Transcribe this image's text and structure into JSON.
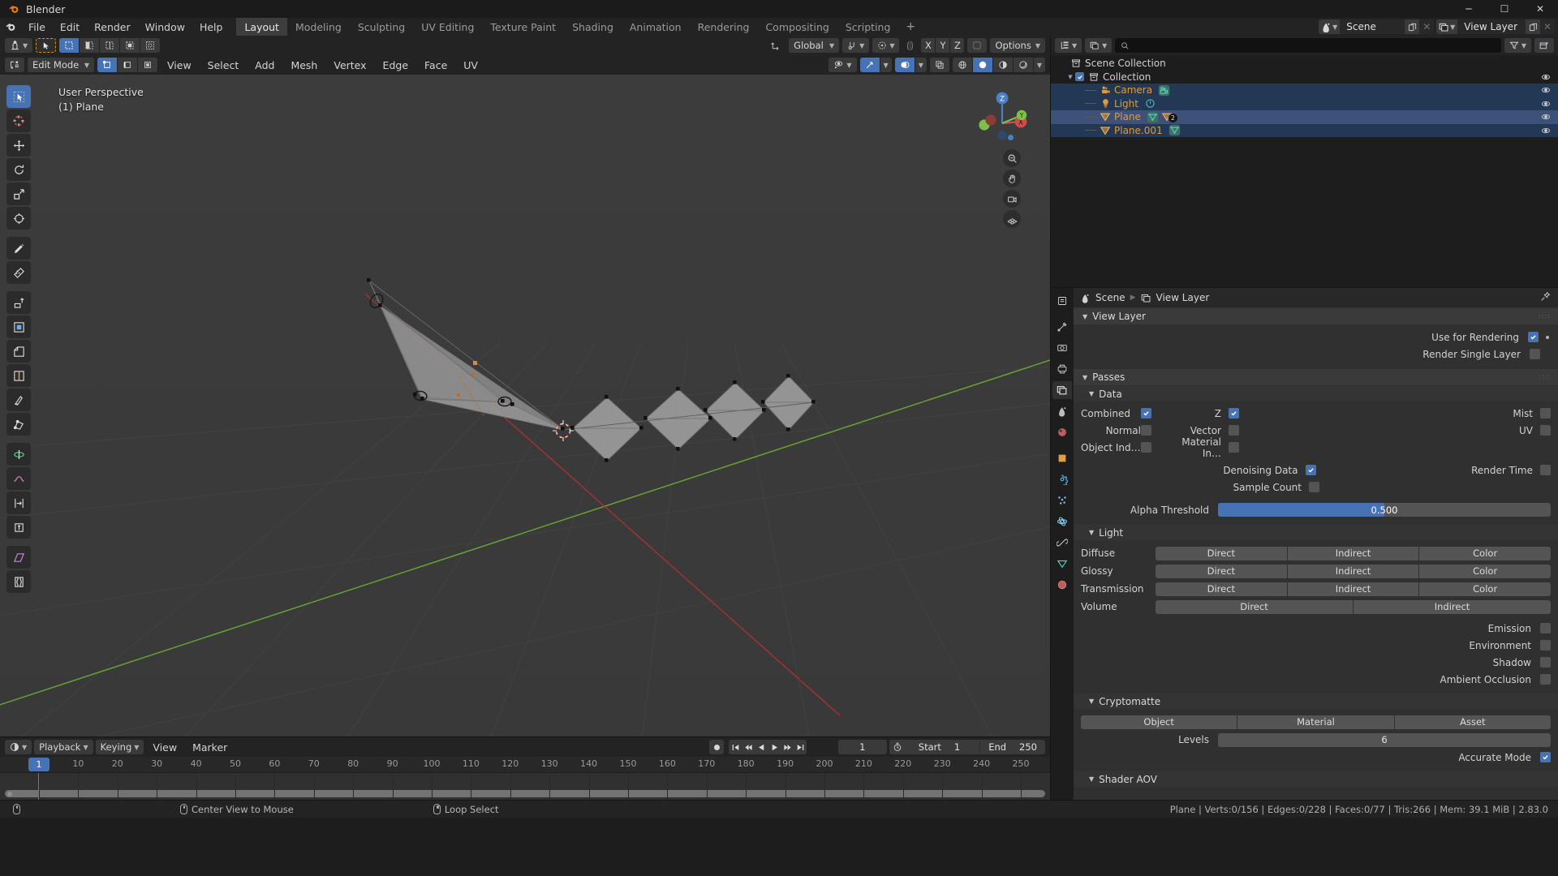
{
  "window": {
    "title": "Blender",
    "minimize": "─",
    "maximize": "☐",
    "close": "✕"
  },
  "topbar": {
    "menus": [
      "File",
      "Edit",
      "Render",
      "Window",
      "Help"
    ],
    "workspaces": [
      "Layout",
      "Modeling",
      "Sculpting",
      "UV Editing",
      "Texture Paint",
      "Shading",
      "Animation",
      "Rendering",
      "Compositing",
      "Scripting"
    ],
    "active_workspace": "Layout",
    "add_workspace": "+",
    "scene": {
      "label": "Scene",
      "icon": "scene-icon",
      "new_btn": "new-scene-icon",
      "close_btn": "✕"
    },
    "view_layer": {
      "label": "View Layer",
      "icon": "view-layer-icon",
      "new_btn": "new-layer-icon",
      "close_btn": "✕"
    }
  },
  "tool_header": {
    "transform_orientation": "Global",
    "options_label": "Options",
    "proportional_axes": [
      "X",
      "Y",
      "Z"
    ]
  },
  "viewport_header": {
    "mode": "Edit Mode",
    "menus": [
      "View",
      "Select",
      "Add",
      "Mesh",
      "Vertex",
      "Edge",
      "Face",
      "UV"
    ],
    "select_modes": [
      "vertex-select",
      "edge-select",
      "face-select"
    ],
    "active_select_mode": "vertex-select"
  },
  "viewport": {
    "perspective_label": "User Perspective",
    "object_label": "(1) Plane",
    "gizmo_axes": [
      "X",
      "Y",
      "Z"
    ],
    "tools": [
      {
        "name": "tweak-tool",
        "active": true
      },
      {
        "name": "cursor-tool",
        "active": false
      },
      {
        "name": "move-tool",
        "active": false
      },
      {
        "name": "rotate-tool",
        "active": false
      },
      {
        "name": "scale-tool",
        "active": false
      },
      {
        "name": "transform-tool",
        "active": false
      },
      {
        "name": "annotate-tool",
        "active": false
      },
      {
        "name": "measure-tool",
        "active": false
      },
      {
        "name": "extrude-region-tool",
        "active": false
      },
      {
        "name": "inset-faces-tool",
        "active": false
      },
      {
        "name": "bevel-tool",
        "active": false
      },
      {
        "name": "loop-cut-tool",
        "active": false
      },
      {
        "name": "knife-tool",
        "active": false
      },
      {
        "name": "poly-build-tool",
        "active": false
      },
      {
        "name": "spin-tool",
        "active": false
      },
      {
        "name": "smooth-tool",
        "active": false
      },
      {
        "name": "edge-slide-tool",
        "active": false
      },
      {
        "name": "shrink-fatten-tool",
        "active": false
      },
      {
        "name": "shear-tool",
        "active": false
      },
      {
        "name": "rip-region-tool",
        "active": false
      }
    ],
    "nav_buttons": [
      "zoom-icon",
      "pan-hand-icon",
      "camera-view-icon",
      "toggle-ortho-icon"
    ]
  },
  "timeline": {
    "menus": [
      "Playback",
      "Keying",
      "View",
      "Marker"
    ],
    "current_frame": "1",
    "start_label": "Start",
    "start_value": "1",
    "end_label": "End",
    "end_value": "250",
    "playhead_frame": "1",
    "ticks": [
      "1",
      "10",
      "20",
      "30",
      "40",
      "50",
      "60",
      "70",
      "80",
      "90",
      "100",
      "110",
      "120",
      "130",
      "140",
      "150",
      "160",
      "170",
      "180",
      "190",
      "200",
      "210",
      "220",
      "230",
      "240",
      "250"
    ]
  },
  "outliner": {
    "search_placeholder": "",
    "rows": [
      {
        "name": "Scene Collection",
        "type": "collection",
        "indent": 0,
        "selected": "none",
        "twisty": false,
        "checkbox": false,
        "eye": false
      },
      {
        "name": "Collection",
        "type": "collection",
        "indent": 1,
        "selected": "none",
        "twisty": true,
        "checkbox": true,
        "eye": true
      },
      {
        "name": "Camera",
        "type": "camera",
        "indent": 2,
        "selected": "dark",
        "twisty": true,
        "checkbox": false,
        "eye": true,
        "data_icon": "camera-data-icon"
      },
      {
        "name": "Light",
        "type": "light",
        "indent": 2,
        "selected": "dark",
        "twisty": true,
        "checkbox": false,
        "eye": true,
        "data_icon": "light-data-icon"
      },
      {
        "name": "Plane",
        "type": "mesh",
        "indent": 2,
        "selected": "active",
        "twisty": true,
        "checkbox": false,
        "eye": true,
        "data_icon": "mesh-data-icon",
        "modifier_badge": "2"
      },
      {
        "name": "Plane.001",
        "type": "mesh",
        "indent": 2,
        "selected": "dark",
        "twisty": true,
        "checkbox": false,
        "eye": true,
        "data_icon": "mesh-data-icon"
      }
    ]
  },
  "properties": {
    "breadcrumb": {
      "scene": "Scene",
      "view_layer": "View Layer"
    },
    "tabs": [
      {
        "name": "tool-tab",
        "active": false
      },
      {
        "name": "render-tab",
        "active": false
      },
      {
        "name": "output-tab",
        "active": false
      },
      {
        "name": "view-layer-tab",
        "active": true
      },
      {
        "name": "scene-tab",
        "active": false
      },
      {
        "name": "world-tab",
        "active": false
      },
      {
        "name": "object-tab",
        "active": false
      },
      {
        "name": "modifier-tab",
        "active": false
      },
      {
        "name": "particles-tab",
        "active": false
      },
      {
        "name": "physics-tab",
        "active": false
      },
      {
        "name": "constraint-tab",
        "active": false
      },
      {
        "name": "object-data-tab",
        "active": false
      },
      {
        "name": "material-tab",
        "active": false
      }
    ],
    "view_layer_panel": {
      "title": "View Layer",
      "use_for_rendering": {
        "label": "Use for Rendering",
        "checked": true
      },
      "render_single_layer": {
        "label": "Render Single Layer",
        "checked": false
      }
    },
    "passes_panel": {
      "title": "Passes"
    },
    "data_panel": {
      "title": "Data",
      "items": [
        {
          "label": "Combined",
          "checked": true
        },
        {
          "label": "Z",
          "checked": true
        },
        {
          "label": "Mist",
          "checked": false
        },
        {
          "label": "Normal",
          "checked": false
        },
        {
          "label": "Vector",
          "checked": false
        },
        {
          "label": "UV",
          "checked": false
        },
        {
          "label": "Object Ind…",
          "checked": false
        },
        {
          "label": "Material In…",
          "checked": false
        }
      ],
      "denoising_data": {
        "label": "Denoising Data",
        "checked": true
      },
      "render_time": {
        "label": "Render Time",
        "checked": false
      },
      "sample_count": {
        "label": "Sample Count",
        "checked": false
      },
      "alpha_threshold": {
        "label": "Alpha Threshold",
        "value": "0.500",
        "fill_percent": 50
      }
    },
    "light_panel": {
      "title": "Light",
      "rows": [
        {
          "label": "Diffuse",
          "buttons": [
            "Direct",
            "Indirect",
            "Color"
          ]
        },
        {
          "label": "Glossy",
          "buttons": [
            "Direct",
            "Indirect",
            "Color"
          ]
        },
        {
          "label": "Transmission",
          "buttons": [
            "Direct",
            "Indirect",
            "Color"
          ]
        },
        {
          "label": "Volume",
          "buttons": [
            "Direct",
            "Indirect"
          ]
        }
      ],
      "checks": [
        {
          "label": "Emission",
          "checked": false
        },
        {
          "label": "Environment",
          "checked": false
        },
        {
          "label": "Shadow",
          "checked": false
        },
        {
          "label": "Ambient Occlusion",
          "checked": false
        }
      ]
    },
    "cryptomatte_panel": {
      "title": "Cryptomatte",
      "buttons": [
        "Object",
        "Material",
        "Asset"
      ],
      "levels_label": "Levels",
      "levels_value": "6",
      "accurate_mode": {
        "label": "Accurate Mode",
        "checked": true
      }
    },
    "shader_aov_panel": {
      "title": "Shader AOV"
    }
  },
  "statusbar": {
    "hints": [
      {
        "icon": "mouse-left-icon",
        "label": ""
      },
      {
        "icon": "mouse-middle-icon",
        "label": "Center View to Mouse"
      },
      {
        "icon": "mouse-right-icon",
        "label": "Loop Select"
      }
    ],
    "stats": "Plane | Verts:0/156 | Edges:0/228 | Faces:0/77 | Tris:266 | Mem: 39.1 MiB | 2.83.0"
  },
  "colors": {
    "accent": "#4772b3",
    "object_name": "#e09a3e",
    "axis_x": "#cf4c4c",
    "axis_y": "#7cc24a",
    "axis_z": "#4a80c8"
  }
}
